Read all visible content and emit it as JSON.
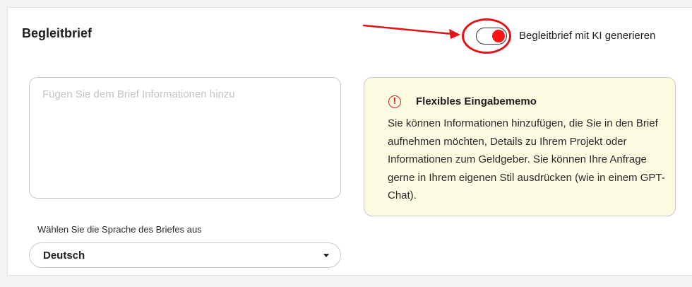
{
  "section": {
    "title": "Begleitbrief"
  },
  "toggle": {
    "label": "Begleitbrief mit KI generieren",
    "state": "on",
    "color": "#ff1414"
  },
  "annotation": {
    "color": "#e2141a"
  },
  "textarea": {
    "placeholder": "Fügen Sie dem Brief Informationen hinzu",
    "value": ""
  },
  "info": {
    "icon": "alert-circle-icon",
    "title": "Flexibles Eingabememo",
    "text": "Sie können Informationen hinzufügen, die Sie in den Brief aufnehmen möchten, Details zu Ihrem Projekt oder Informationen zum Geldgeber. Sie können Ihre Anfrage gerne in Ihrem eigenen Stil ausdrücken (wie in einem GPT-Chat).",
    "background": "#fdfbe2"
  },
  "language": {
    "label": "Wählen Sie die Sprache des Briefes aus",
    "selected": "Deutsch"
  }
}
